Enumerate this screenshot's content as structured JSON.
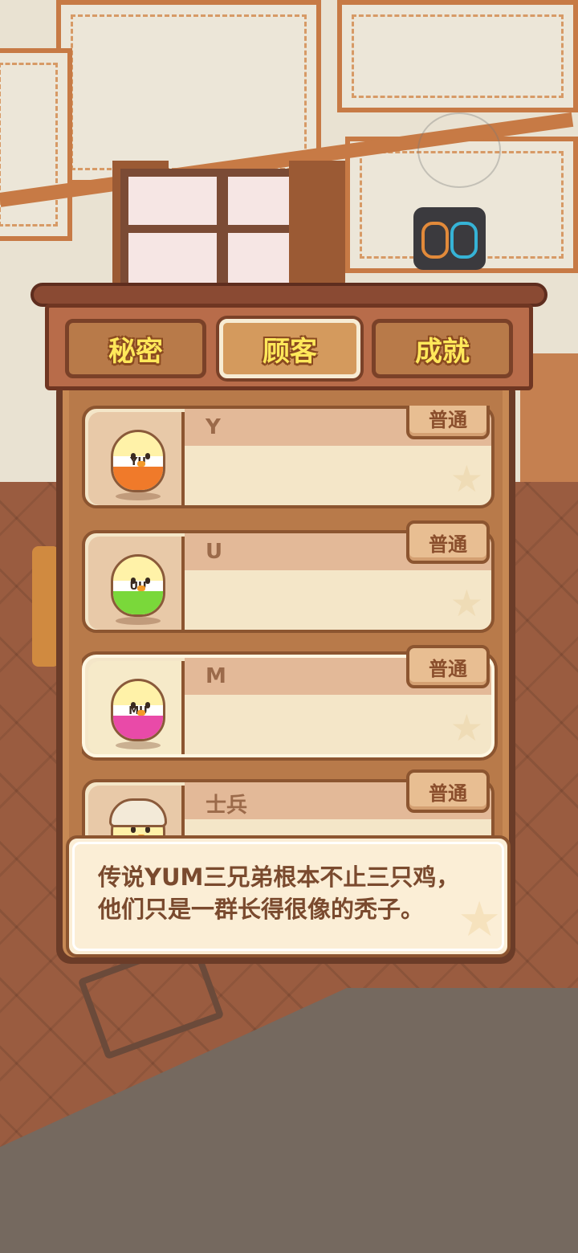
{
  "tabs": [
    {
      "label": "秘密",
      "active": false
    },
    {
      "label": "顾客",
      "active": true
    },
    {
      "label": "成就",
      "active": false
    }
  ],
  "customers": [
    {
      "name": "Y",
      "rarity": "普通",
      "letters": "YU",
      "shirt_color": "#f07a2a",
      "selected": false
    },
    {
      "name": "U",
      "rarity": "普通",
      "letters": "UU",
      "shirt_color": "#7ad83a",
      "selected": false
    },
    {
      "name": "M",
      "rarity": "普通",
      "letters": "MU",
      "shirt_color": "#e94aa8",
      "selected": true
    },
    {
      "name": "士兵",
      "rarity": "普通",
      "letters": "",
      "shirt_color": "#e07a30",
      "selected": false
    }
  ],
  "description": {
    "line1": "传说YUM三兄弟根本不止三只鸡，",
    "line2": "他们只是一群长得很像的秃子。"
  },
  "colors": {
    "tab_text": "#ffe85a",
    "panel": "#c78954",
    "card": "#f4e6c8",
    "border": "#8c5530"
  }
}
